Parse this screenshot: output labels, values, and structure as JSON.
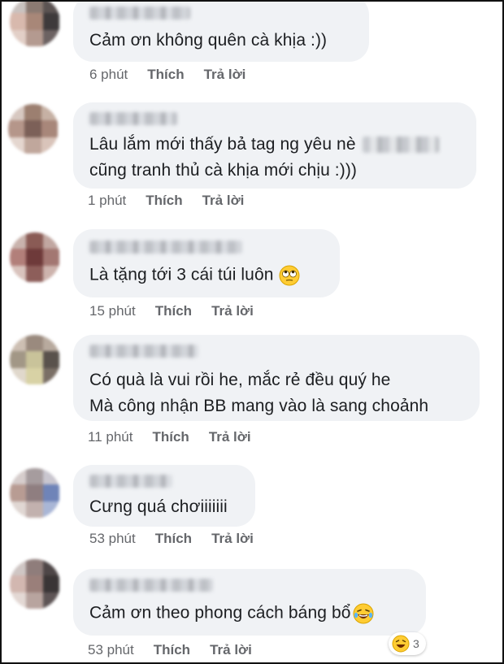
{
  "comments": [
    {
      "lines": [
        "Cảm ơn không quên cà khịa :))"
      ],
      "time": "6 phút",
      "like": "Thích",
      "reply": "Trả lời"
    },
    {
      "lines": [
        "Lâu lắm mới thấy bả tag ng yêu nè",
        "cũng tranh thủ cà khịa mới chịu :)))"
      ],
      "time": "1 phút",
      "like": "Thích",
      "reply": "Trả lời"
    },
    {
      "lines": [
        "Là tặng tới 3 cái túi luôn"
      ],
      "emoji": "eye-roll-emoji",
      "time": "15 phút",
      "like": "Thích",
      "reply": "Trả lời"
    },
    {
      "lines": [
        "Có quà là vui rồi he, mắc rẻ đều quý he",
        "Mà công nhận BB mang vào là sang choảnh"
      ],
      "time": "11 phút",
      "like": "Thích",
      "reply": "Trả lời"
    },
    {
      "lines": [
        "Cưng quá chơiiiiiii"
      ],
      "time": "53 phút",
      "like": "Thích",
      "reply": "Trả lời"
    },
    {
      "lines": [
        "Cảm ơn theo phong cách báng bổ"
      ],
      "emoji": "laughing-tears-emoji",
      "time": "53 phút",
      "like": "Thích",
      "reply": "Trả lời",
      "reaction": {
        "icon": "laughing-reaction-icon",
        "count": "3"
      }
    }
  ],
  "colors": {
    "bubble": "#f0f2f5",
    "text": "#1c1e21",
    "meta": "#65676b",
    "border": "#111111"
  }
}
